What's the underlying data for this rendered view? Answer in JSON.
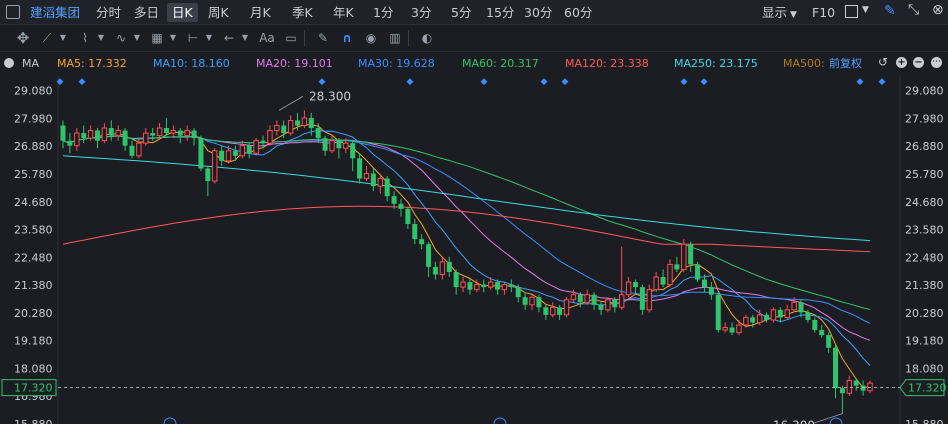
{
  "header": {
    "stock_name": "建滔集团",
    "tabs": [
      "分时",
      "多日",
      "日K",
      "周K",
      "月K",
      "季K",
      "年K",
      "1分",
      "3分",
      "5分",
      "15分",
      "30分",
      "60分"
    ],
    "active_tab": "日K",
    "display_label": "显示",
    "f10_label": "F10"
  },
  "toolbar": {
    "icons": [
      "move-icon",
      "line-tool-icon",
      "polyline-tool-icon",
      "wave-tool-icon",
      "pattern-tool-icon",
      "range-tool-icon",
      "arrow-tool-icon",
      "text-tool-icon",
      "comment-tool-icon",
      "brush-icon",
      "magnet-icon",
      "eye-icon",
      "trash-icon",
      "toggle-icon"
    ],
    "text_label": "Aa"
  },
  "indicators": {
    "label": "MA",
    "items": [
      {
        "text": "MA5: 17.332",
        "color": "#f5a623"
      },
      {
        "text": "MA10: 18.160",
        "color": "#3aa0ff"
      },
      {
        "text": "MA20: 19.101",
        "color": "#e07ce8"
      },
      {
        "text": "MA30: 19.628",
        "color": "#3a8cff"
      },
      {
        "text": "MA60: 20.317",
        "color": "#2ec46c"
      },
      {
        "text": "MA120: 23.338",
        "color": "#ff5a5a"
      },
      {
        "text": "MA250: 23.175",
        "color": "#3ad9e6"
      },
      {
        "text": "MA500:",
        "color": "#b07a1a"
      }
    ],
    "adjust_label": "前复权"
  },
  "chart_data": {
    "type": "candlestick",
    "y_ticks": [
      29.08,
      27.98,
      26.88,
      25.78,
      24.68,
      23.58,
      22.48,
      21.38,
      20.28,
      19.18,
      18.08,
      15.88
    ],
    "y_range": [
      15.88,
      29.66
    ],
    "current_price": "17.320",
    "partial_tick": "16.980",
    "annotations": {
      "high": "28.300",
      "low": "16.300"
    },
    "up_color": "#ff4d4f",
    "down_color": "#2ec46c",
    "candles": [
      [
        27.7,
        27.1,
        27.9,
        26.8
      ],
      [
        27.1,
        26.9,
        27.4,
        26.6
      ],
      [
        26.9,
        27.4,
        27.6,
        26.7
      ],
      [
        27.4,
        27.2,
        27.7,
        27.0
      ],
      [
        27.2,
        27.5,
        27.7,
        27.1
      ],
      [
        27.5,
        27.1,
        27.6,
        26.8
      ],
      [
        27.1,
        27.6,
        27.8,
        27.0
      ],
      [
        27.6,
        27.3,
        27.9,
        27.1
      ],
      [
        27.3,
        27.5,
        27.7,
        27.1
      ],
      [
        27.5,
        26.9,
        27.6,
        26.7
      ],
      [
        26.9,
        26.5,
        27.1,
        26.4
      ],
      [
        26.5,
        27.0,
        27.2,
        26.4
      ],
      [
        27.0,
        27.4,
        27.6,
        26.9
      ],
      [
        27.4,
        27.3,
        27.6,
        27.1
      ],
      [
        27.3,
        27.6,
        27.8,
        27.2
      ],
      [
        27.6,
        27.4,
        28.0,
        27.3
      ],
      [
        27.4,
        27.5,
        27.7,
        27.2
      ],
      [
        27.5,
        27.3,
        27.6,
        27.0
      ],
      [
        27.3,
        27.5,
        27.7,
        27.1
      ],
      [
        27.5,
        27.2,
        27.6,
        26.9
      ],
      [
        27.2,
        26.0,
        27.3,
        25.9
      ],
      [
        26.0,
        25.5,
        26.1,
        24.9
      ],
      [
        25.5,
        26.7,
        26.8,
        25.4
      ],
      [
        26.7,
        26.3,
        26.9,
        26.1
      ],
      [
        26.3,
        26.7,
        26.9,
        26.2
      ],
      [
        26.7,
        26.5,
        26.9,
        26.3
      ],
      [
        26.5,
        26.9,
        27.1,
        26.4
      ],
      [
        26.9,
        26.6,
        27.0,
        26.4
      ],
      [
        26.6,
        27.1,
        27.2,
        26.5
      ],
      [
        27.1,
        27.0,
        27.3,
        26.8
      ],
      [
        27.0,
        27.5,
        27.7,
        26.9
      ],
      [
        27.5,
        27.7,
        27.9,
        27.3
      ],
      [
        27.7,
        27.4,
        27.9,
        27.2
      ],
      [
        27.4,
        27.9,
        28.1,
        27.3
      ],
      [
        27.9,
        27.7,
        28.2,
        27.5
      ],
      [
        27.7,
        28.0,
        28.3,
        27.6
      ],
      [
        28.0,
        27.6,
        28.2,
        27.3
      ],
      [
        27.6,
        27.2,
        27.8,
        27.0
      ],
      [
        27.2,
        26.7,
        27.3,
        26.5
      ],
      [
        26.7,
        27.1,
        27.3,
        26.6
      ],
      [
        27.1,
        26.8,
        27.2,
        26.4
      ],
      [
        26.8,
        27.0,
        27.2,
        26.6
      ],
      [
        27.0,
        26.4,
        27.1,
        25.9
      ],
      [
        26.4,
        25.6,
        26.6,
        25.4
      ],
      [
        25.6,
        25.8,
        26.1,
        25.5
      ],
      [
        25.8,
        25.3,
        26.0,
        25.1
      ],
      [
        25.3,
        25.6,
        25.8,
        25.0
      ],
      [
        25.6,
        24.9,
        25.7,
        24.7
      ],
      [
        24.9,
        24.6,
        25.1,
        24.4
      ],
      [
        24.6,
        24.4,
        24.8,
        24.1
      ],
      [
        24.4,
        23.8,
        24.5,
        23.6
      ],
      [
        23.8,
        23.2,
        24.0,
        23.0
      ],
      [
        23.2,
        23.0,
        23.4,
        22.8
      ],
      [
        23.0,
        22.1,
        23.1,
        21.7
      ],
      [
        22.1,
        21.8,
        22.3,
        21.6
      ],
      [
        21.8,
        22.3,
        22.5,
        21.6
      ],
      [
        22.3,
        21.9,
        22.5,
        21.7
      ],
      [
        21.9,
        21.3,
        22.0,
        21.0
      ],
      [
        21.3,
        21.5,
        21.7,
        21.1
      ],
      [
        21.5,
        21.2,
        21.6,
        21.0
      ],
      [
        21.2,
        21.4,
        21.6,
        21.1
      ],
      [
        21.4,
        21.3,
        21.6,
        21.1
      ],
      [
        21.3,
        21.5,
        21.7,
        21.2
      ],
      [
        21.5,
        21.2,
        21.6,
        21.0
      ],
      [
        21.2,
        21.4,
        21.5,
        21.0
      ],
      [
        21.4,
        21.3,
        21.6,
        21.1
      ],
      [
        21.3,
        20.9,
        21.4,
        20.7
      ],
      [
        20.9,
        20.6,
        21.1,
        20.4
      ],
      [
        20.6,
        20.9,
        21.0,
        20.4
      ],
      [
        20.9,
        20.5,
        21.0,
        20.3
      ],
      [
        20.5,
        20.2,
        20.6,
        20.0
      ],
      [
        20.2,
        20.5,
        20.7,
        20.1
      ],
      [
        20.5,
        20.2,
        20.6,
        20.0
      ],
      [
        20.2,
        20.8,
        20.9,
        20.1
      ],
      [
        20.8,
        21.0,
        21.2,
        20.7
      ],
      [
        21.0,
        20.7,
        21.1,
        20.5
      ],
      [
        20.7,
        21.0,
        21.2,
        20.6
      ],
      [
        21.0,
        20.6,
        21.1,
        20.4
      ],
      [
        20.6,
        20.4,
        20.7,
        20.2
      ],
      [
        20.4,
        20.8,
        20.9,
        20.3
      ],
      [
        20.8,
        20.5,
        20.9,
        20.3
      ],
      [
        20.5,
        21.0,
        22.9,
        20.4
      ],
      [
        21.0,
        21.5,
        21.7,
        20.9
      ],
      [
        21.5,
        21.3,
        21.6,
        21.0
      ],
      [
        21.3,
        20.4,
        21.4,
        20.2
      ],
      [
        20.4,
        21.2,
        21.4,
        20.3
      ],
      [
        21.2,
        21.7,
        21.9,
        21.1
      ],
      [
        21.7,
        21.4,
        22.0,
        21.3
      ],
      [
        21.4,
        22.2,
        22.4,
        21.3
      ],
      [
        22.2,
        22.0,
        22.5,
        21.9
      ],
      [
        22.0,
        23.0,
        23.2,
        21.9
      ],
      [
        23.0,
        22.2,
        23.1,
        21.9
      ],
      [
        22.2,
        21.6,
        22.3,
        21.5
      ],
      [
        21.6,
        21.3,
        21.8,
        21.1
      ],
      [
        21.3,
        21.0,
        21.5,
        20.8
      ],
      [
        21.0,
        19.6,
        21.1,
        19.5
      ],
      [
        19.6,
        19.7,
        19.9,
        19.5
      ],
      [
        19.7,
        19.5,
        19.9,
        19.4
      ],
      [
        19.5,
        19.8,
        20.0,
        19.4
      ],
      [
        19.8,
        20.1,
        20.2,
        19.7
      ],
      [
        20.1,
        19.9,
        20.2,
        19.7
      ],
      [
        19.9,
        20.2,
        20.4,
        19.8
      ],
      [
        20.2,
        20.0,
        20.3,
        19.9
      ],
      [
        20.0,
        20.4,
        20.5,
        19.9
      ],
      [
        20.4,
        20.1,
        20.5,
        19.9
      ],
      [
        20.1,
        20.4,
        20.6,
        20.0
      ],
      [
        20.4,
        20.7,
        20.9,
        20.3
      ],
      [
        20.7,
        20.3,
        20.8,
        20.1
      ],
      [
        20.3,
        20.0,
        20.4,
        19.9
      ],
      [
        20.0,
        19.6,
        20.1,
        19.5
      ],
      [
        19.6,
        19.4,
        19.8,
        19.3
      ],
      [
        19.4,
        18.9,
        19.5,
        18.7
      ],
      [
        18.9,
        17.3,
        19.0,
        16.9
      ],
      [
        17.3,
        17.1,
        17.4,
        16.3
      ],
      [
        17.1,
        17.6,
        17.8,
        17.0
      ],
      [
        17.6,
        17.4,
        17.7,
        17.2
      ],
      [
        17.4,
        17.2,
        17.6,
        17.0
      ],
      [
        17.2,
        17.5,
        17.6,
        17.1
      ]
    ]
  }
}
